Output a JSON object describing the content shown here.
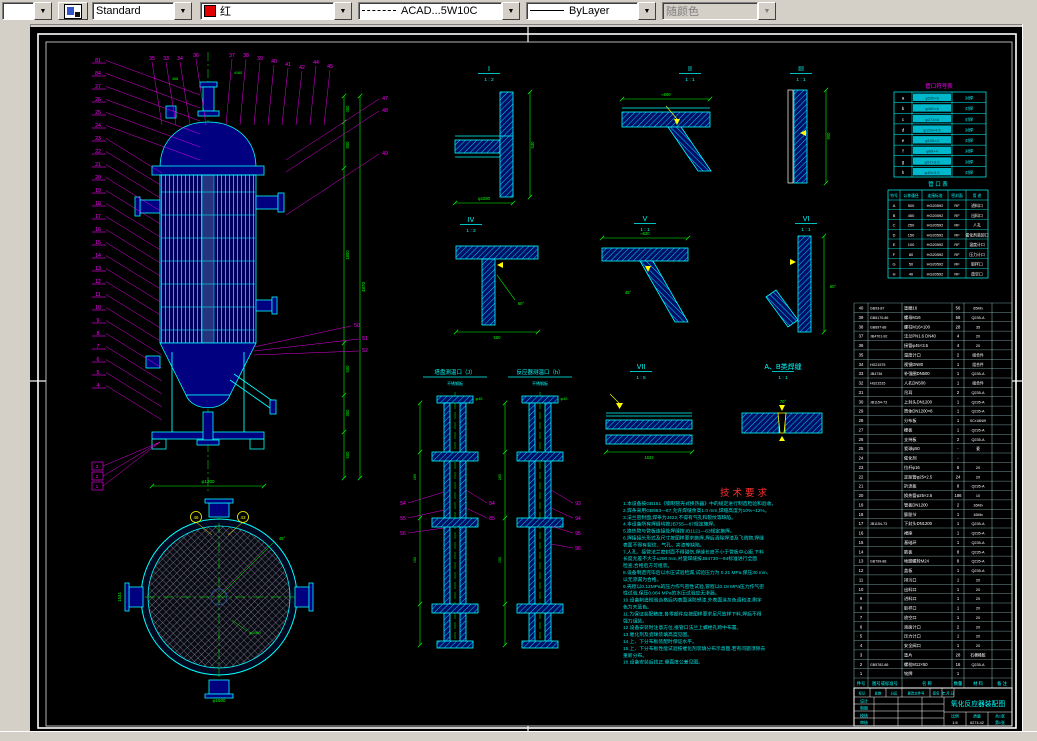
{
  "toolbar": {
    "style": "Standard",
    "color": "红",
    "linetype": "ACAD...5W10C",
    "lineweight": "ByLayer",
    "plotstyle": "随颜色"
  },
  "details": [
    {
      "label": "I",
      "scale": "1 : 2"
    },
    {
      "label": "II",
      "scale": "1 : 1"
    },
    {
      "label": "III",
      "scale": "1 : 1"
    },
    {
      "label": "IV",
      "scale": "1 : 2"
    },
    {
      "label": "V",
      "scale": "1 : 1"
    },
    {
      "label": "VI",
      "scale": "1 : 1"
    },
    {
      "label": "VII",
      "scale": "1 : 5"
    },
    {
      "label": "A、B类焊缝",
      "scale": "1 : 1"
    }
  ],
  "nozzle_details": [
    {
      "title": "塔盘测温口（J）",
      "sub": "不锈钢板"
    },
    {
      "title": "反应器测温口（h）",
      "sub": "不锈钢板"
    }
  ],
  "balloons": {
    "left": [
      "81",
      "84",
      "27",
      "26",
      "25",
      "24",
      "23",
      "22",
      "21",
      "20",
      "19",
      "18",
      "17",
      "16",
      "15",
      "14",
      "13",
      "12",
      "11",
      "10",
      "9",
      "8",
      "7",
      "6",
      "5",
      "4"
    ],
    "boxed": [
      "3",
      "2",
      "1"
    ],
    "top": [
      "35",
      "33",
      "34",
      "36",
      "37",
      "38",
      "39",
      "40",
      "41",
      "42",
      "44",
      "45"
    ],
    "right": [
      "47",
      "48",
      "49",
      "50",
      "51",
      "52"
    ],
    "circle": [
      "43",
      "46"
    ],
    "nozzleL": [
      "54",
      "55",
      "56"
    ],
    "nozzleM": [
      "84",
      "85"
    ],
    "nozzleR": [
      "93",
      "94",
      "95",
      "96"
    ]
  },
  "dims": {
    "m1": "450",
    "m2": "800",
    "m3": "1800",
    "m4": "500",
    "m5": "350",
    "m6": "600",
    "overall": "4870",
    "bottom": "φ1200",
    "top_a": "468",
    "top_b": "4160",
    "c_left": "1534",
    "c_bottom": "φ1500",
    "c_mesh": "φ1060",
    "c_ang": "45°",
    "d1": "530",
    "d1b": "φ1080",
    "d2": "≈600",
    "d3": "900",
    "d4": "560",
    "d4a": "60°",
    "d5": "45°",
    "d5b": "≈620",
    "d6": "60°",
    "d7": "1632",
    "d8": "70°",
    "nz_top": "φ45",
    "nz_a": "260",
    "nz_b": "150"
  },
  "tech": {
    "title": "技术要求",
    "lines": [
      "1.本设备按GB151《钢制管壳式换热器》中的规定进行制造检验和验收。",
      "2.焊条采用GB983—87,允许焊缝余高1.0 mm,焊缝高度为10%~12%。",
      "3.法兰密封面,焊条为J422,不得有气孔和裂纹等缺陷。",
      "4.本设备所有焊缝均按JB755—87规定施焊。",
      "5.换热管与管板连接处焊缝按JB1121—63规定施焊。",
      "6.焊接接头形式及尺寸按图样要求施焊,焊后清除焊渣及飞溅物,焊缝",
      "   表面不得有裂纹、气孔、夹渣等缺陷。",
      "7.人孔、接管法兰密封面不得碰伤,焊缝长度不小于管板中心距,下料",
      "   长度允差不大于±200 mm,衬里焊缝按JB4730—94标准进行全面",
      "   检查,合格后方可组装。",
      "8.设备制造完毕后以水压试验检漏,试验压力为 0.21 MPa,保压30 min,",
      "   以无渗漏为合格。",
      "9.壳程以0.12MPa的压力作气密性试验,管程以0.18 MPa压力作气密",
      "   性试验,保压0.064 MPa的水压试验应无渗漏。",
      "10.设备制造检验合格后内表面涂防锈漆,外表面涂灰色调和漆,刷字",
      "   色为天蓝色。",
      "11.为保证装配精度,各零部件应按图样要求足尺放样下料,焊后不得",
      "   强力组装。",
      "12.设备安装时注意方位,接管口法兰上螺栓孔跨中布置。",
      "13.催化剂及瓷球装填高度见图。",
      "14.上、下分布板装配时保证水平。",
      "15.上、下分布板性能试验按催化剂装填分布示意图,若有问题须除去",
      "   重新分布。",
      "16.设备安装后找正,垂直度公差见图。"
    ]
  },
  "port_symbol_table": {
    "title": "管口符号表",
    "rows": [
      [
        "a",
        "φ530×6",
        "对焊"
      ],
      [
        "b",
        "φ480×6",
        "对焊"
      ],
      [
        "c",
        "φ273×8",
        "对焊"
      ],
      [
        "d",
        "φ159×4.5",
        "对焊"
      ],
      [
        "e",
        "φ108×4",
        "对焊"
      ],
      [
        "f",
        "φ89×4",
        "对焊"
      ],
      [
        "g",
        "φ57×3.5",
        "对焊"
      ],
      [
        "h",
        "φ45×3.5",
        "对焊"
      ]
    ]
  },
  "port_table": {
    "title": "管 口 表",
    "headers": [
      "符号",
      "公称通径",
      "连接标准",
      "密封面",
      "用 途"
    ],
    "rows": [
      [
        "A",
        "500",
        "HG20592",
        "RF",
        "进料口"
      ],
      [
        "B",
        "450",
        "HG20592",
        "RF",
        "出料口"
      ],
      [
        "C",
        "250",
        "HG20592",
        "RF",
        "人孔"
      ],
      [
        "D",
        "150",
        "HG20592",
        "RF",
        "催化剂装卸口"
      ],
      [
        "E",
        "100",
        "HG20592",
        "RF",
        "温度计口"
      ],
      [
        "F",
        "80",
        "HG20592",
        "RF",
        "压力计口"
      ],
      [
        "G",
        "50",
        "HG20592",
        "RF",
        "取样口"
      ],
      [
        "H",
        "40",
        "HG20592",
        "RF",
        "放空口"
      ]
    ]
  },
  "bom": {
    "headers": [
      "件号",
      "图号或标准号",
      "名 称",
      "数量",
      "材 料",
      "备 注"
    ],
    "rows": [
      [
        "40",
        "GB93-87",
        "垫圈16",
        "56",
        "65Mn",
        ""
      ],
      [
        "39",
        "GB6170-86",
        "螺母M16",
        "56",
        "Q235-A",
        ""
      ],
      [
        "38",
        "GB897-88",
        "螺柱M16×100",
        "28",
        "35",
        ""
      ],
      [
        "37",
        "JB4701-92",
        "法兰PN1.6 DN40",
        "4",
        "20",
        ""
      ],
      [
        "36",
        "",
        "接管φ45×3.5",
        "4",
        "20",
        ""
      ],
      [
        "35",
        "",
        "温度计口",
        "2",
        "组合件",
        ""
      ],
      [
        "34",
        "HG21575",
        "视镜DN80",
        "1",
        "组合件",
        ""
      ],
      [
        "33",
        "JB4736",
        "补强圈DN500",
        "1",
        "Q235-A",
        ""
      ],
      [
        "32",
        "HG21515",
        "人孔DN500",
        "1",
        "组合件",
        ""
      ],
      [
        "31",
        "",
        "吊耳",
        "2",
        "Q235-A",
        ""
      ],
      [
        "30",
        "JB1154-73",
        "上封头DN1200",
        "1",
        "Q235-A",
        ""
      ],
      [
        "29",
        "",
        "筒体DN1200×8",
        "1",
        "Q235-A",
        ""
      ],
      [
        "28",
        "",
        "分布板",
        "1",
        "0Cr18Ni9",
        ""
      ],
      [
        "27",
        "",
        "栅板",
        "1",
        "Q235-A",
        ""
      ],
      [
        "26",
        "",
        "支持板",
        "2",
        "Q235-A",
        ""
      ],
      [
        "25",
        "",
        "瓷球φ50",
        "-",
        "瓷",
        ""
      ],
      [
        "24",
        "",
        "催化剂",
        "-",
        "",
        ""
      ],
      [
        "23",
        "",
        "拉杆φ16",
        "6",
        "20",
        ""
      ],
      [
        "22",
        "",
        "定距管φ25×2.5",
        "24",
        "20",
        ""
      ],
      [
        "21",
        "",
        "折流板",
        "8",
        "Q235-A",
        ""
      ],
      [
        "20",
        "",
        "换热管φ25×2.5",
        "186",
        "10",
        ""
      ],
      [
        "19",
        "",
        "管板DN1200",
        "2",
        "16Mn",
        ""
      ],
      [
        "18",
        "",
        "膨胀节",
        "1",
        "16Mn",
        ""
      ],
      [
        "17",
        "JB1154-73",
        "下封头DN1200",
        "1",
        "Q235-A",
        ""
      ],
      [
        "16",
        "",
        "裙座",
        "1",
        "Q235-A",
        ""
      ],
      [
        "15",
        "",
        "基础环",
        "1",
        "Q235-A",
        ""
      ],
      [
        "14",
        "",
        "筋板",
        "8",
        "Q235-A",
        ""
      ],
      [
        "13",
        "GB799-88",
        "地脚螺栓M24",
        "8",
        "Q235-A",
        ""
      ],
      [
        "12",
        "",
        "盖板",
        "1",
        "Q235-A",
        ""
      ],
      [
        "11",
        "",
        "排污口",
        "1",
        "20",
        ""
      ],
      [
        "10",
        "",
        "出料口",
        "1",
        "20",
        ""
      ],
      [
        "9",
        "",
        "进料口",
        "1",
        "20",
        ""
      ],
      [
        "8",
        "",
        "取样口",
        "1",
        "20",
        ""
      ],
      [
        "7",
        "",
        "放空口",
        "1",
        "20",
        ""
      ],
      [
        "6",
        "",
        "液面计口",
        "2",
        "20",
        ""
      ],
      [
        "5",
        "",
        "压力计口",
        "1",
        "20",
        ""
      ],
      [
        "4",
        "",
        "安全阀口",
        "1",
        "20",
        ""
      ],
      [
        "3",
        "",
        "垫片",
        "28",
        "石棉橡胶",
        ""
      ],
      [
        "2",
        "GB5782-86",
        "螺栓M12×50",
        "16",
        "Q235-A",
        ""
      ],
      [
        "1",
        "",
        "铭牌",
        "1",
        "",
        ""
      ]
    ]
  },
  "titleblock": {
    "title": "氧化反应器装配图",
    "top_row": [
      "标记",
      "处数",
      "分区",
      "更改文件号",
      "签名",
      "年.月.日"
    ],
    "sign_rows": [
      "设计",
      "制图",
      "校核",
      "审核"
    ],
    "scale_label": "比例",
    "scale": "1:5",
    "mass_label": "质量",
    "mass": "6274.42",
    "sheet_a": "共1张",
    "sheet_b": "第1张"
  }
}
